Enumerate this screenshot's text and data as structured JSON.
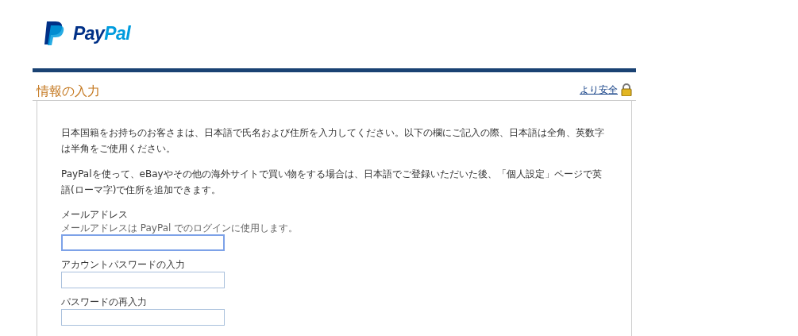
{
  "logo": {
    "first": "Pay",
    "second": "Pal"
  },
  "title": "情報の入力",
  "secure_link": "より安全",
  "paragraphs": [
    "日本国籍をお持ちのお客さまは、日本語で氏名および住所を入力してください。以下の欄にご記入の際、日本語は全角、英数字は半角をご使用ください。",
    "PayPalを使って、eBayやその他の海外サイトで買い物をする場合は、日本語でご登録いただいた後、「個人設定」ページで英語(ローマ字)で住所を追加できます。"
  ],
  "fields": [
    {
      "label": "メールアドレス",
      "hint": "メールアドレスは PayPal でのログインに使用します。",
      "focused": true
    },
    {
      "label": "アカウントパスワードの入力",
      "focused": false
    },
    {
      "label": "パスワードの再入力",
      "focused": false
    }
  ]
}
